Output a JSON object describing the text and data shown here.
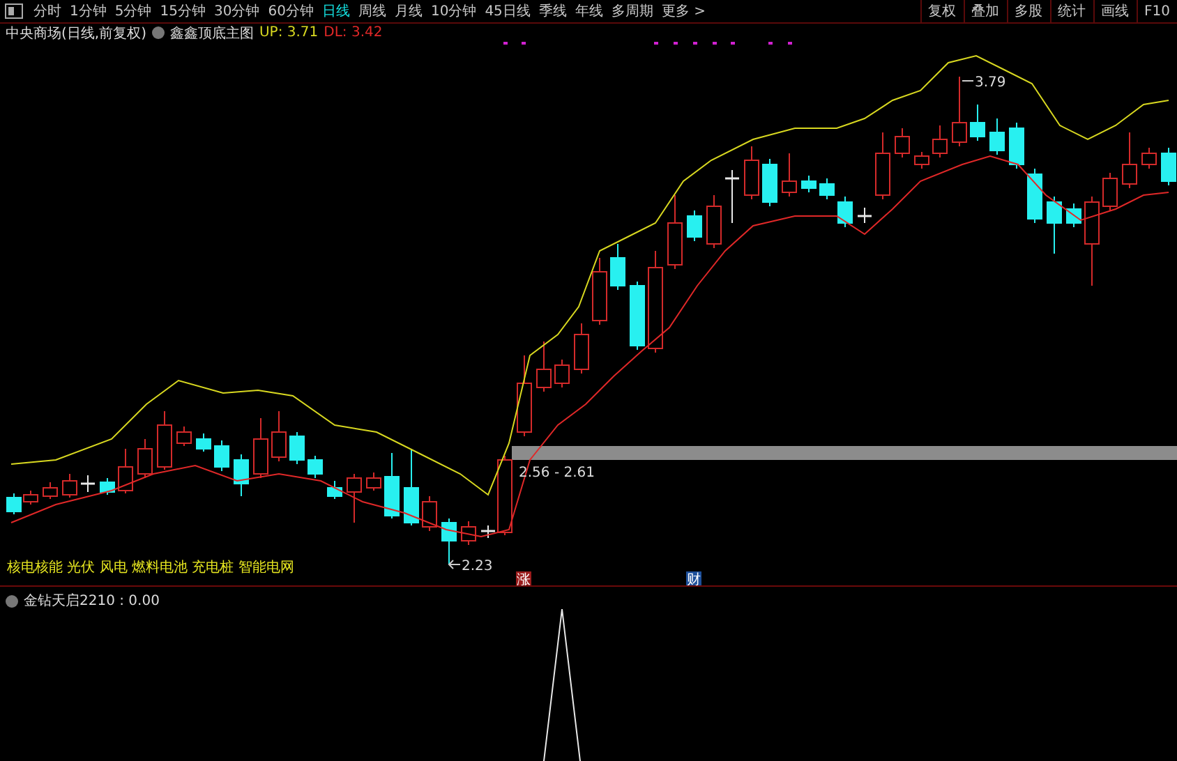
{
  "toolbar": {
    "periods": [
      {
        "label": "分时",
        "selected": false
      },
      {
        "label": "1分钟",
        "selected": false
      },
      {
        "label": "5分钟",
        "selected": false
      },
      {
        "label": "15分钟",
        "selected": false
      },
      {
        "label": "30分钟",
        "selected": false
      },
      {
        "label": "60分钟",
        "selected": false
      },
      {
        "label": "日线",
        "selected": true
      },
      {
        "label": "周线",
        "selected": false
      },
      {
        "label": "月线",
        "selected": false
      },
      {
        "label": "10分钟",
        "selected": false
      },
      {
        "label": "45日线",
        "selected": false
      },
      {
        "label": "季线",
        "selected": false
      },
      {
        "label": "年线",
        "selected": false
      },
      {
        "label": "多周期",
        "selected": false
      },
      {
        "label": "更多 >",
        "selected": false
      }
    ],
    "buttons": [
      "复权",
      "叠加",
      "多股",
      "统计",
      "画线",
      "F10"
    ]
  },
  "main_chart": {
    "title": "中央商场(日线,前复权)",
    "indicator": "鑫鑫顶底主图",
    "lines": [
      {
        "text": "UP: 3.71",
        "color": "#d8d820"
      },
      {
        "text": "DL: 3.42",
        "color": "#e02828"
      }
    ],
    "high_label": "3.79",
    "low_label": "2.23",
    "range_label": "2.56 - 2.61",
    "concepts": "核电核能 光伏 风电 燃料电池 充电桩 智能电网",
    "events": [
      {
        "text": "涨",
        "color": "#9a1c1c"
      },
      {
        "text": "财",
        "color": "#1d4f9a"
      }
    ]
  },
  "lower_pane": {
    "title": "金钻天启2210 : 0.00"
  }
}
